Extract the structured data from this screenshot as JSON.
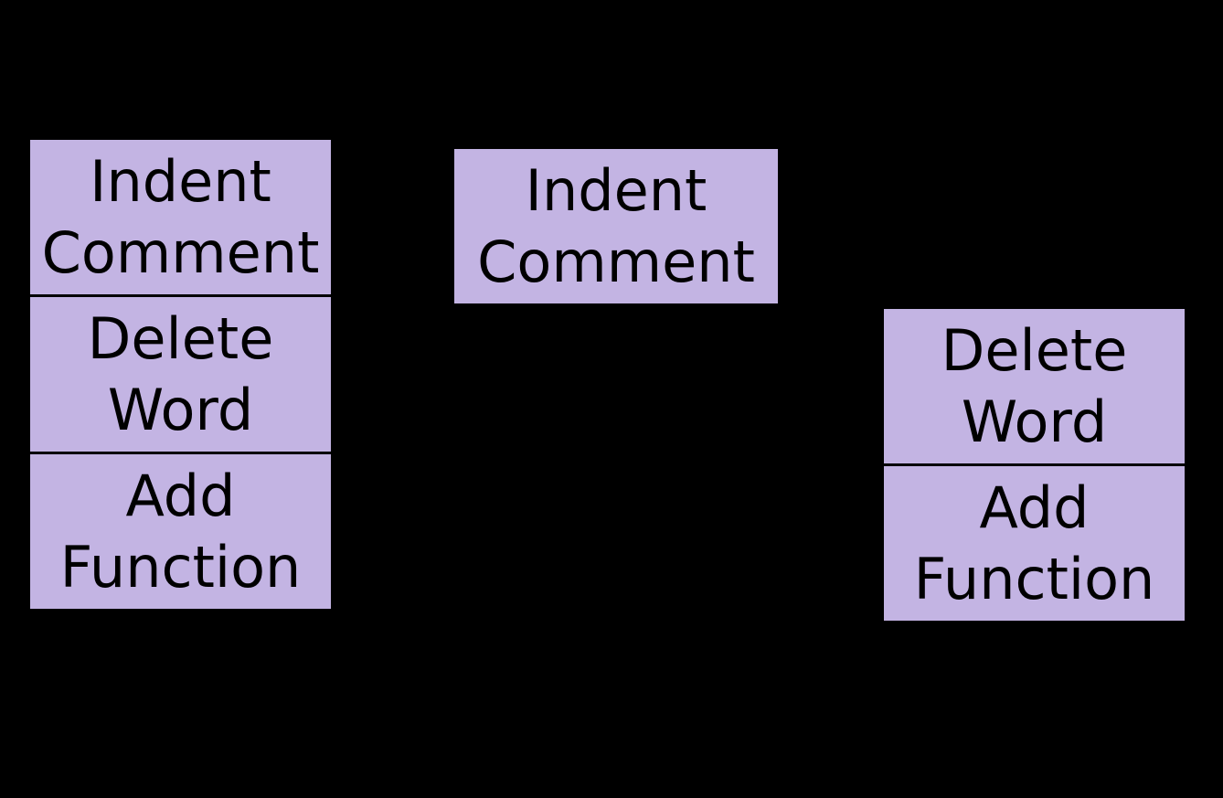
{
  "box_color": "#c3b4e3",
  "stacks": {
    "left": {
      "items": [
        {
          "line1": "Indent",
          "line2": "Comment"
        },
        {
          "line1": "Delete",
          "line2": "Word"
        },
        {
          "line1": "Add",
          "line2": "Function"
        }
      ]
    },
    "middle": {
      "items": [
        {
          "line1": "Indent",
          "line2": "Comment"
        }
      ]
    },
    "right": {
      "items": [
        {
          "line1": "Delete",
          "line2": "Word"
        },
        {
          "line1": "Add",
          "line2": "Function"
        }
      ]
    }
  }
}
